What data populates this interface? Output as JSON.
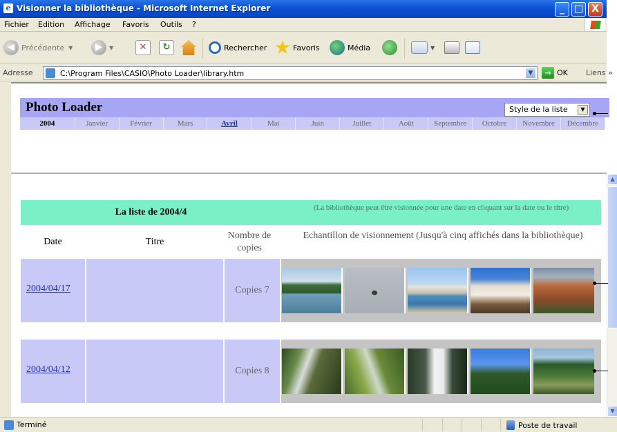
{
  "window": {
    "title": "Visionner la bibliothèque - Microsoft Internet Explorer",
    "buttons": {
      "minimize": "_",
      "maximize": "□",
      "close": "X"
    }
  },
  "menu": [
    "Fichier",
    "Edition",
    "Affichage",
    "Favoris",
    "Outils",
    "?"
  ],
  "toolbar": {
    "back": "Précédente",
    "search": "Rechercher",
    "favorites": "Favoris",
    "media": "Média"
  },
  "address": {
    "label": "Adresse",
    "value": "C:\\Program Files\\CASIO\\Photo Loader\\library.htm",
    "go": "OK",
    "links": "Liens »"
  },
  "header": {
    "title": "Photo Loader",
    "style_select": "Style de la liste",
    "year": "2004",
    "months": [
      "Janvier",
      "Février",
      "Mars",
      "Avril",
      "Mai",
      "Juin",
      "Juillet",
      "Août",
      "Septembre",
      "Octobre",
      "Novembre",
      "Décembre"
    ],
    "active_month_index": 3
  },
  "library": {
    "list_title": "La liste de 2004/4",
    "hint": "(La bibliothèque peut être visionnée pour une date en cliquant sur la date ou le titre)",
    "columns": {
      "date": "Date",
      "title": "Titre",
      "copies": "Nombre de copies",
      "sample": "Echantillon de visionnement (Jusqu'à cinq affichés dans la bibliothèque)"
    },
    "rows": [
      {
        "date": "2004/04/17",
        "copies": "Copies 7",
        "photos": [
          "island-sea-photo",
          "seagull-sky-photo",
          "harbor-town-photo",
          "white-village-photo",
          "canyon-photo"
        ]
      },
      {
        "date": "2004/04/12",
        "copies": "Copies 8",
        "photos": [
          "stream-rocks-photo",
          "mossy-stream-photo",
          "waterfall-photo",
          "tall-trees-photo",
          "marsh-photo"
        ]
      }
    ]
  },
  "status": {
    "text": "Terminé",
    "zone": "Poste de travail"
  },
  "colors": {
    "header_band": "#a6a6f4",
    "month_band": "#c9c9f8",
    "list_header": "#7af0c6",
    "row_bg": "#c9c9f8",
    "link": "#1f2fb8"
  }
}
